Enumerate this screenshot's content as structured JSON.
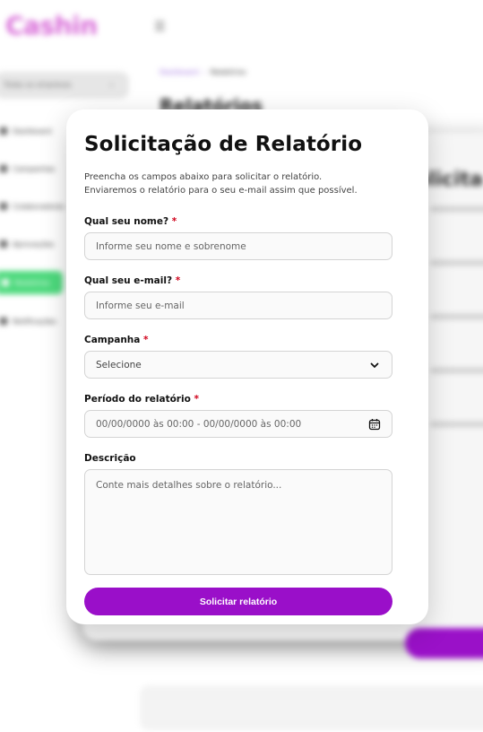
{
  "background": {
    "logo": "Cashin",
    "menu_toggle": "☰",
    "company_select": "Todas as empresas",
    "nav_items": [
      "Dashboard",
      "Campanhas",
      "Colaboradores",
      "Aprovações",
      "Relatórios",
      "Notificações"
    ],
    "breadcrumb_home": "Dashboard",
    "breadcrumb_current": "Relatórios",
    "page_title": "Relatórios",
    "modal_title_fragment": "olicita"
  },
  "modal": {
    "title": "Solicitação de Relatório",
    "subtitle_line1": "Preencha os campos abaixo para solicitar o relatório.",
    "subtitle_line2": "Enviaremos o relatório para o seu e-mail assim que possível.",
    "required_mark": "*",
    "fields": {
      "name": {
        "label": "Qual seu nome?",
        "placeholder": "Informe seu nome e sobrenome"
      },
      "email": {
        "label": "Qual seu e-mail?",
        "placeholder": "Informe seu e-mail"
      },
      "campaign": {
        "label": "Campanha",
        "selected": "Selecione"
      },
      "period": {
        "label": "Período do relatório",
        "placeholder": "00/00/0000 às 00:00 - 00/00/0000 às 00:00"
      },
      "description": {
        "label": "Descrição",
        "placeholder": "Conte mais detalhes sobre o relatório..."
      }
    },
    "submit_label": "Solicitar relatório"
  },
  "colors": {
    "accent": "#9a0fc9",
    "required": "#d0021b",
    "logo": "#d86ad8",
    "active_nav": "#4cd97c"
  },
  "icons": {
    "campaign": "chevron-down-icon",
    "period": "calendar-icon"
  }
}
